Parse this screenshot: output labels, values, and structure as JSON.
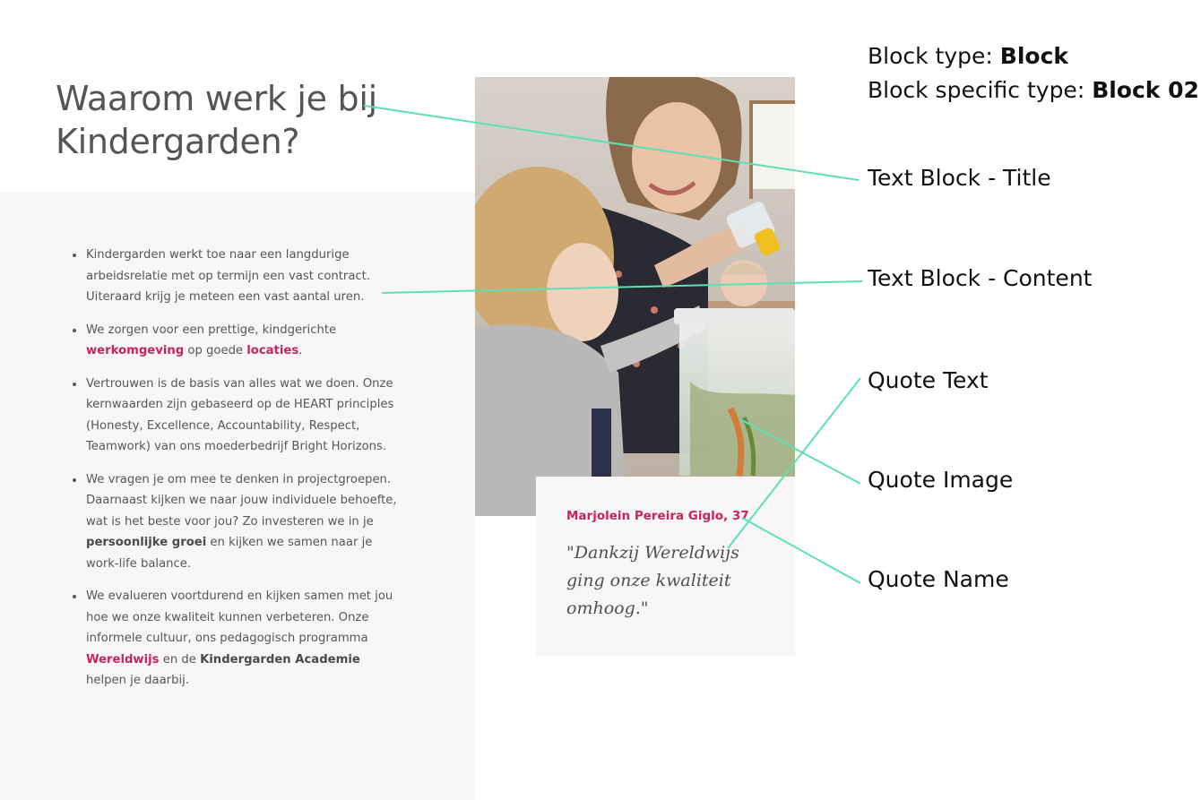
{
  "meta": {
    "block_type_label": "Block type: ",
    "block_type_value": "Block",
    "specific_type_label": "Block specific type: ",
    "specific_type_value": "Block 02"
  },
  "title": "Waarom werk je bij Kindergarden?",
  "bullets": [
    {
      "text": "Kindergarden werkt toe naar een langdurige arbeidsrelatie met op termijn een vast contract. Uiteraard krijg je meteen een vast aantal uren."
    },
    {
      "pre": "We zorgen voor een prettige, kindgerichte ",
      "link1": "werkomgeving",
      "mid": " op goede ",
      "link2": "locaties",
      "post": "."
    },
    {
      "text": "Vertrouwen is de basis van alles wat we doen. Onze kernwaarden zijn gebaseerd op de HEART principles (Honesty, Excellence, Accountability, Respect, Teamwork) van ons moederbedrijf Bright Horizons."
    },
    {
      "pre": "We vragen je om mee te denken in projectgroepen. Daarnaast kijken we naar jouw individuele behoefte, wat is het beste voor jou? Zo investeren we in je ",
      "bold": "persoonlijke groei",
      "post": " en kijken we samen naar je work-life balance."
    },
    {
      "pre": "We evalueren voortdurend en kijken samen met jou hoe we onze kwaliteit kunnen verbeteren. Onze informele cultuur, ons pedagogisch programma ",
      "link": "Wereldwijs",
      "mid": " en de ",
      "bold": "Kindergarden Academie",
      "post": " helpen je daarbij."
    }
  ],
  "quote": {
    "name": "Marjolein Pereira Giglo, 37",
    "text": "\"Dankzij Wereldwijs ging onze kwaliteit omhoog.\""
  },
  "annotations": {
    "title": "Text Block - Title",
    "content": "Text Block - Content",
    "quote_text": "Quote Text",
    "quote_image": "Quote Image",
    "quote_name": "Quote Name"
  },
  "colors": {
    "accent": "#c8235f",
    "connector": "#5fe0b4",
    "panel_bg": "#f8f7f5"
  },
  "icons": [
    "photo-teacher-child-aquarium"
  ]
}
